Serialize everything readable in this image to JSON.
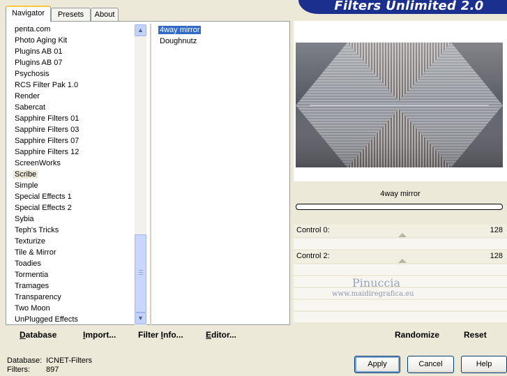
{
  "tabs": [
    "Navigator",
    "Presets",
    "About"
  ],
  "title": "Filters Unlimited 2.0",
  "categories": [
    "penta.com",
    "Photo Aging Kit",
    "Plugins AB 01",
    "Plugins AB 07",
    "Psychosis",
    "RCS Filter Pak 1.0",
    "Render",
    "Sabercat",
    "Sapphire Filters 01",
    "Sapphire Filters 03",
    "Sapphire Filters 07",
    "Sapphire Filters 12",
    "ScreenWorks",
    "Scribe",
    "Simple",
    "Special Effects 1",
    "Special Effects 2",
    "Sybia",
    "Teph's Tricks",
    "Texturize",
    "Tile & Mirror",
    "Toadies",
    "Tormentia",
    "Tramages",
    "Transparency",
    "Two Moon",
    "UnPlugged Effects"
  ],
  "highlighted_category": "Scribe",
  "filters": [
    "4way mirror",
    "Doughnutz"
  ],
  "selected_filter": "4way mirror",
  "bottom_buttons": {
    "database_first": "D",
    "database_rest": "atabase",
    "import_first": "I",
    "import_rest": "mport...",
    "filterinfo_a": "Filter ",
    "filterinfo_first": "I",
    "filterinfo_rest": "nfo...",
    "editor_first": "E",
    "editor_rest": "ditor..."
  },
  "preview_filter_name": "4way mirror",
  "controls": [
    {
      "label": "Control 0:",
      "value": "128"
    },
    {
      "label": "Control 2:",
      "value": "128"
    }
  ],
  "randomize_label": "Randomize",
  "reset_label": "Reset",
  "watermark": {
    "name": "Pinuccia",
    "url": "www.maidiregrafica.eu"
  },
  "status": {
    "database_label": "Database:",
    "database_value": "ICNET-Filters",
    "filters_label": "Filters:",
    "filters_value": "897"
  },
  "dialog_buttons": {
    "apply": "Apply",
    "cancel": "Cancel",
    "help": "Help"
  },
  "colors": {
    "banner": "#1b2f8f",
    "selection": "#316ac5",
    "face": "#ece9d8"
  }
}
